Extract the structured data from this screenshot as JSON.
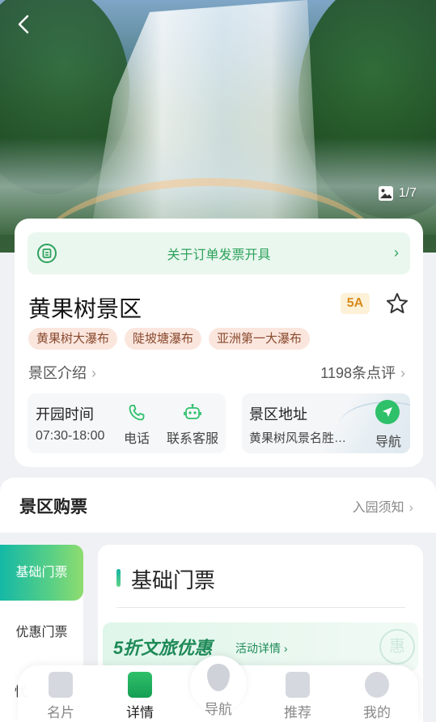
{
  "hero": {
    "back_label": "‹",
    "photo_count": "1/7"
  },
  "invoice": {
    "text": "关于订单发票开具",
    "arrow": "›"
  },
  "spot": {
    "name": "黄果树景区",
    "level": "5A",
    "tags": [
      "黄果树大瀑布",
      "陡坡塘瀑布",
      "亚洲第一大瀑布"
    ],
    "intro_link": "景区介绍",
    "reviews_link": "1198条点评"
  },
  "hours": {
    "title": "开园时间",
    "time": "07:30-18:00",
    "phone_label": "电话",
    "service_label": "联系客服"
  },
  "address": {
    "title": "景区地址",
    "text": "黄果树风景名胜…",
    "nav_label": "导航"
  },
  "tickets": {
    "section_title": "景区购票",
    "notice_link": "入园须知",
    "side_tabs": [
      "基础门票",
      "优惠门票",
      "忧"
    ],
    "panel_title": "基础门票",
    "promo_main": "5折文旅优惠",
    "promo_link": "活动详情",
    "promo_stamp": "惠"
  },
  "bottom_nav": {
    "items": [
      "名片",
      "详情",
      "导航",
      "推荐",
      "我的"
    ]
  },
  "colors": {
    "accent_green": "#2da25c",
    "badge_orange": "#d98a1c",
    "tag_bg": "#fbe6de"
  }
}
